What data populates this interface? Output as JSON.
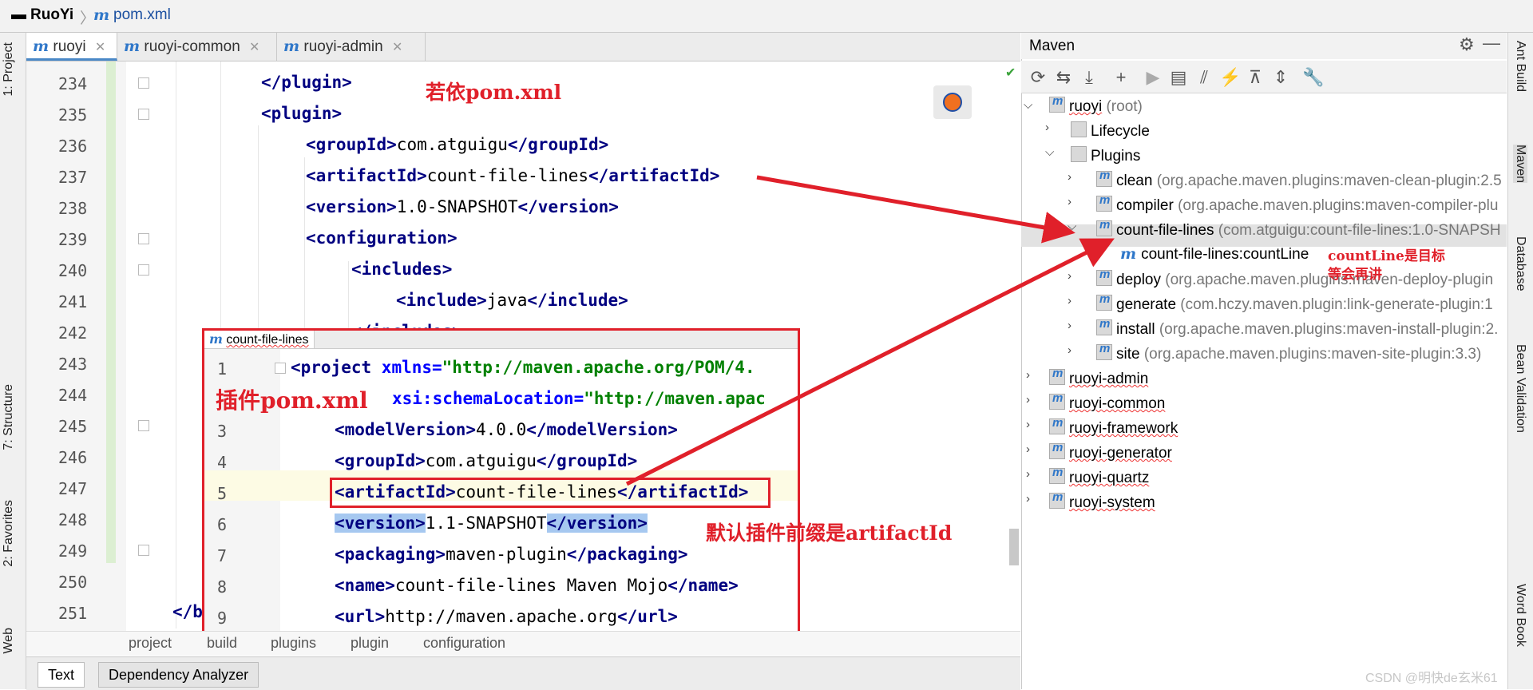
{
  "breadcrumb": {
    "project": "RuoYi",
    "file": "pom.xml"
  },
  "left_stripe": [
    "1: Project",
    "7: Structure",
    "2: Favorites",
    "Web"
  ],
  "right_stripe": [
    "Ant Build",
    "Maven",
    "Database",
    "Bean Validation",
    "Word Book"
  ],
  "editor_tabs": [
    {
      "label": "ruoyi",
      "active": true
    },
    {
      "label": "ruoyi-common",
      "active": false
    },
    {
      "label": "ruoyi-admin",
      "active": false
    }
  ],
  "editor": {
    "line_numbers": [
      "234",
      "235",
      "236",
      "237",
      "238",
      "239",
      "240",
      "241",
      "242",
      "243",
      "244",
      "245",
      "246",
      "247",
      "248",
      "249",
      "250",
      "251"
    ],
    "lines": {
      "l234": "</plugin>",
      "l235": "<plugin>",
      "l236a": "<groupId>",
      "l236b": "com.atguigu",
      "l236c": "</groupId>",
      "l237a": "<artifactId>",
      "l237b": "count-file-lines",
      "l237c": "</artifactId>",
      "l238a": "<version>",
      "l238b": "1.0-SNAPSHOT",
      "l238c": "</version>",
      "l239": "<configuration>",
      "l240": "<includes>",
      "l241a": "<include>",
      "l241b": "java",
      "l241c": "</include>",
      "l242": "</includes>",
      "l251": "</b"
    }
  },
  "popup": {
    "tab": "count-file-lines",
    "line_numbers": [
      "1",
      "",
      "3",
      "4",
      "5",
      "6",
      "7",
      "8",
      "9"
    ],
    "l1a": "<project ",
    "l1b": "xmlns=",
    "l1c": "\"http://maven.apache.org/POM/4.",
    "l2b": "xsi:schemaLocation=",
    "l2c": "\"http://maven.apac",
    "l3a": "<modelVersion>",
    "l3b": "4.0.0",
    "l3c": "</modelVersion>",
    "l4a": "<groupId>",
    "l4b": "com.atguigu",
    "l4c": "</groupId>",
    "l5a": "<artifactId>",
    "l5b": "count-file-lines",
    "l5c": "</artifactId>",
    "l6a": "<version>",
    "l6b": "1.1-SNAPSHOT",
    "l6c": "</version>",
    "l7a": "<packaging>",
    "l7b": "maven-plugin",
    "l7c": "</packaging>",
    "l8a": "<name>",
    "l8b": "count-file-lines Maven Mojo",
    "l8c": "</name>",
    "l9a": "<url>",
    "l9b": "http://maven.apache.org",
    "l9c": "</url>"
  },
  "path_bar": [
    "project",
    "build",
    "plugins",
    "plugin",
    "configuration"
  ],
  "bottom_tabs": [
    "Text",
    "Dependency Analyzer"
  ],
  "annotations": {
    "ruoyi_pom": "若依pom.xml",
    "plugin_pom": "插件pom.xml",
    "default_prefix": "默认插件前缀是artifactId",
    "count_line_1": "countLine是目标",
    "count_line_2": "等会再讲"
  },
  "maven": {
    "title": "Maven",
    "root": {
      "name": "ruoyi",
      "suffix": " (root)"
    },
    "lifecycle": "Lifecycle",
    "plugins_label": "Plugins",
    "plugins": [
      {
        "name": "clean",
        "detail": " (org.apache.maven.plugins:maven-clean-plugin:2.5"
      },
      {
        "name": "compiler",
        "detail": " (org.apache.maven.plugins:maven-compiler-plu"
      },
      {
        "name": "count-file-lines",
        "detail": " (com.atguigu:count-file-lines:1.0-SNAPSH"
      },
      {
        "name": "deploy",
        "detail": " (org.apache.maven.plugins:maven-deploy-plugin"
      },
      {
        "name": "generate",
        "detail": " (com.hczy.maven.plugin:link-generate-plugin:1"
      },
      {
        "name": "install",
        "detail": " (org.apache.maven.plugins:maven-install-plugin:2."
      },
      {
        "name": "site",
        "detail": " (org.apache.maven.plugins:maven-site-plugin:3.3)"
      }
    ],
    "goal": "count-file-lines:countLine",
    "modules": [
      "ruoyi-admin",
      "ruoyi-common",
      "ruoyi-framework",
      "ruoyi-generator",
      "ruoyi-quartz",
      "ruoyi-system"
    ]
  },
  "watermark": "CSDN @明快de玄米61",
  "colors": {
    "annotation_red": "#e0202a",
    "tag_navy": "#000080",
    "attr_blue": "#0000ff",
    "string_green": "#008000",
    "selection": "#a6c8f0"
  }
}
